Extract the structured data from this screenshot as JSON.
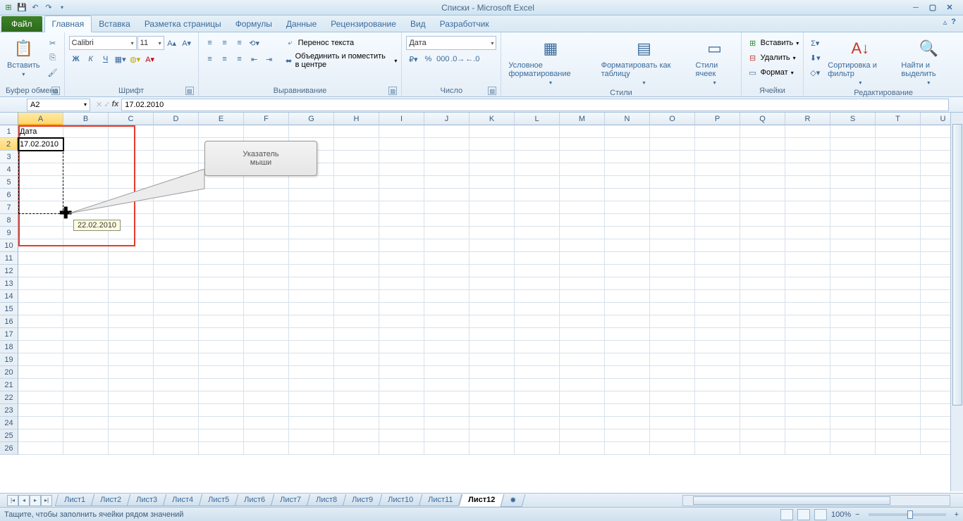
{
  "title": "Списки  -  Microsoft Excel",
  "qat": {
    "save": "💾",
    "undo": "↶",
    "redo": "↷"
  },
  "tabs": {
    "file": "Файл",
    "home": "Главная",
    "insert": "Вставка",
    "layout": "Разметка страницы",
    "formulas": "Формулы",
    "data": "Данные",
    "review": "Рецензирование",
    "view": "Вид",
    "dev": "Разработчик"
  },
  "ribbon": {
    "clipboard": {
      "label": "Буфер обмена",
      "paste": "Вставить"
    },
    "font": {
      "label": "Шрифт",
      "name": "Calibri",
      "size": "11",
      "bold": "Ж",
      "italic": "К",
      "underline": "Ч"
    },
    "align": {
      "label": "Выравнивание",
      "wrap": "Перенос текста",
      "merge": "Объединить и поместить в центре"
    },
    "number": {
      "label": "Число",
      "format": "Дата"
    },
    "styles": {
      "label": "Стили",
      "cond": "Условное форматирование",
      "table": "Форматировать как таблицу",
      "cell": "Стили ячеек"
    },
    "cells": {
      "label": "Ячейки",
      "insert": "Вставить",
      "delete": "Удалить",
      "format": "Формат"
    },
    "editing": {
      "label": "Редактирование",
      "sort": "Сортировка и фильтр",
      "find": "Найти и выделить"
    }
  },
  "namebox": "A2",
  "formula": "17.02.2010",
  "columns": [
    "A",
    "B",
    "C",
    "D",
    "E",
    "F",
    "G",
    "H",
    "I",
    "J",
    "K",
    "L",
    "M",
    "N",
    "O",
    "P",
    "Q",
    "R",
    "S",
    "T",
    "U"
  ],
  "rows": [
    "1",
    "2",
    "3",
    "4",
    "5",
    "6",
    "7",
    "8",
    "9",
    "10",
    "11",
    "12",
    "13",
    "14",
    "15",
    "16",
    "17",
    "18",
    "19",
    "20",
    "21",
    "22",
    "23",
    "24",
    "25",
    "26"
  ],
  "cellA1": "Дата",
  "cellA2": "17.02.2010",
  "fill_tooltip": "22.02.2010",
  "callout": {
    "line1": "Указатель",
    "line2": "мыши"
  },
  "sheets": [
    "Лист1",
    "Лист2",
    "Лист3",
    "Лист4",
    "Лист5",
    "Лист6",
    "Лист7",
    "Лист8",
    "Лист9",
    "Лист10",
    "Лист11",
    "Лист12"
  ],
  "status": "Тащите, чтобы заполнить ячейки рядом значений",
  "zoom": "100%"
}
